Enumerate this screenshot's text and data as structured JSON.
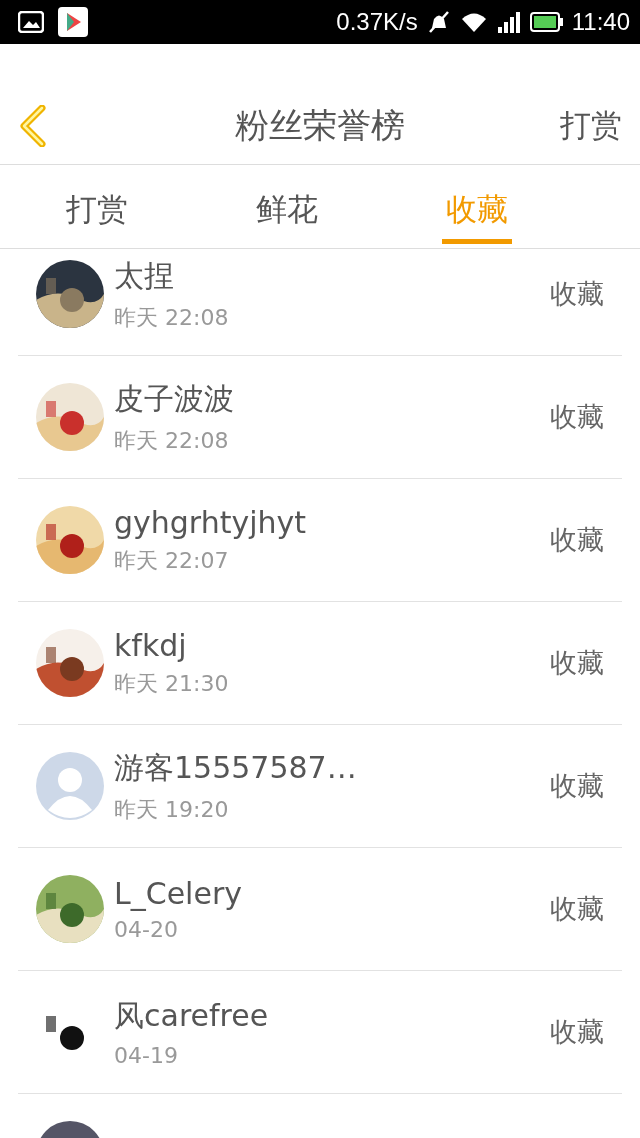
{
  "status_bar": {
    "speed": "0.37K/s",
    "time": "11:40"
  },
  "header": {
    "title": "粉丝荣誉榜",
    "action": "打赏"
  },
  "tabs": [
    {
      "label": "打赏",
      "selected": false
    },
    {
      "label": "鲜花",
      "selected": false
    },
    {
      "label": "收藏",
      "selected": true
    }
  ],
  "rows": [
    {
      "name": "太捏",
      "time": "昨天 22:08",
      "action": "收藏",
      "kind": "picture"
    },
    {
      "name": "皮子波波",
      "time": "昨天 22:08",
      "action": "收藏",
      "kind": "picture"
    },
    {
      "name": "gyhgrhtyjhyt",
      "time": "昨天 22:07",
      "action": "收藏",
      "kind": "picture"
    },
    {
      "name": "kfkdj",
      "time": "昨天 21:30",
      "action": "收藏",
      "kind": "picture"
    },
    {
      "name": "游客15557587…",
      "time": "昨天 19:20",
      "action": "收藏",
      "kind": "default"
    },
    {
      "name": "L_Celery",
      "time": "04-20",
      "action": "收藏",
      "kind": "picture"
    },
    {
      "name": "风carefree",
      "time": "04-19",
      "action": "收藏",
      "kind": "picture"
    },
    {
      "kind": "picture"
    }
  ]
}
